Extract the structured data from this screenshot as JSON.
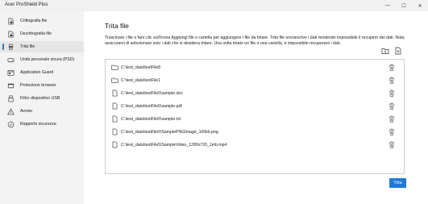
{
  "window": {
    "app_title": "Acer ProShield Plus",
    "controls": [
      "—",
      "☐",
      "✕"
    ]
  },
  "sidebar": {
    "items": [
      {
        "label": "Crittografia file",
        "icon": "file-lock-icon"
      },
      {
        "label": "Decrittografia file",
        "icon": "file-unlock-icon"
      },
      {
        "label": "Trita file",
        "icon": "shred-icon",
        "active": true
      },
      {
        "label": "Unità personale sicura (PSD)",
        "icon": "drive-icon"
      },
      {
        "label": "Application Guard",
        "icon": "app-guard-icon"
      },
      {
        "label": "Protezione browser",
        "icon": "browser-icon"
      },
      {
        "label": "Filtro dispositivo USB",
        "icon": "usb-icon"
      },
      {
        "label": "Avviso",
        "icon": "warning-icon"
      },
      {
        "label": "Rapporto sicurezza",
        "icon": "report-icon"
      }
    ]
  },
  "main": {
    "title": "Trita file",
    "description": "Trascinare i file o fare clic sull'icona Aggiungi file o cartella per aggiungere i file da tritare. Trita file sovrascrive i dati rendendo impossibile il recupero dei dati. Nota: assicurarsi di selezionare solo i dati che si desidera tritare. Una volta tritato un file o una cartella, è impossibile recuperare i dati.",
    "files": [
      {
        "path": "C:\\test_data\\testFile8",
        "type": "folder"
      },
      {
        "path": "C:\\test_data\\testFile1",
        "type": "folder"
      },
      {
        "path": "C:\\test_data\\testFile5\\sample.doc",
        "type": "file"
      },
      {
        "path": "C:\\test_data\\testFile5\\sample.pdf",
        "type": "file"
      },
      {
        "path": "C:\\test_data\\testFile5\\sample.txt",
        "type": "file"
      },
      {
        "path": "C:\\test_data\\testFile5\\SamplePNGImage_100kb.png",
        "type": "file"
      },
      {
        "path": "C:\\test_data\\testFile5\\SampleVideo_1280x720_1mb.mp4",
        "type": "file"
      }
    ],
    "shred_button_label": "Trita"
  }
}
